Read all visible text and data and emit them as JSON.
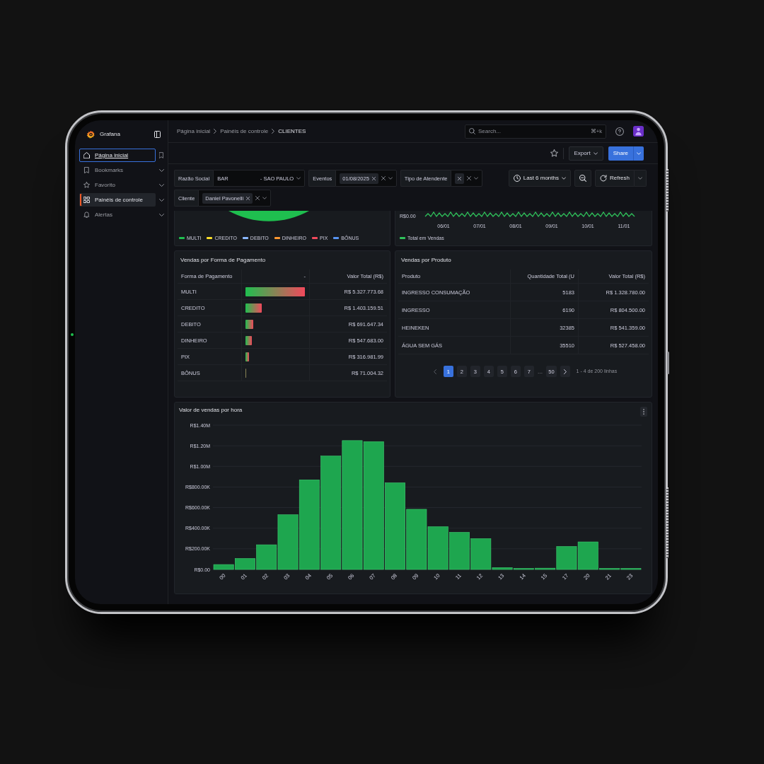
{
  "sidebar": {
    "brand": "Grafana",
    "items": [
      {
        "label": "Página inicial",
        "selected": false,
        "focused": true,
        "expandable": false
      },
      {
        "label": "Bookmarks",
        "selected": false,
        "focused": false,
        "expandable": true
      },
      {
        "label": "Favorito",
        "selected": false,
        "focused": false,
        "expandable": true
      },
      {
        "label": "Painéis de controle",
        "selected": true,
        "focused": false,
        "expandable": true
      },
      {
        "label": "Alertas",
        "selected": false,
        "focused": false,
        "expandable": true
      }
    ]
  },
  "header": {
    "breadcrumbs": [
      "Página inicial",
      "Painéis de controle",
      "CLIENTES"
    ],
    "search": {
      "placeholder": "Search...",
      "shortcut": "⌘+k"
    }
  },
  "toolbar": {
    "buttons": [
      {
        "label": "Export",
        "kind": "dropdown"
      },
      {
        "label": "Share",
        "kind": "split"
      }
    ]
  },
  "variable_rows": [
    [
      {
        "label": "Razão Social",
        "kind": "single",
        "value": "BAR",
        "value_suffix": "- SAO PAULO"
      },
      {
        "label": "Eventos",
        "kind": "multi",
        "chips": [
          {
            "kind": "text",
            "label": "01/08/2025"
          }
        ]
      },
      {
        "label": "Tipo de Atendente",
        "kind": "multi",
        "chips": [
          {
            "kind": "blank"
          }
        ]
      }
    ],
    [
      {
        "label": "Cliente",
        "kind": "multi",
        "chips": [
          {
            "kind": "text",
            "label": "Daniel Pavonelli"
          }
        ]
      }
    ]
  ],
  "time_range": {
    "label": "Last 6 months"
  },
  "refresh": {
    "label": "Refresh"
  },
  "pie_panel": {
    "legend": [
      {
        "label": "MULTI",
        "color": "#1fbf4f"
      },
      {
        "label": "CREDITO",
        "color": "#fade2a"
      },
      {
        "label": "DEBITO",
        "color": "#8ab8ff"
      },
      {
        "label": "DINHEIRO",
        "color": "#ff9830"
      },
      {
        "label": "PIX",
        "color": "#f2495c"
      },
      {
        "label": "BÔNUS",
        "color": "#5794f2"
      }
    ]
  },
  "line_panel": {
    "y_tick": "R$0.00",
    "x_ticks": [
      "06/01",
      "07/01",
      "08/01",
      "09/01",
      "10/01",
      "11/01"
    ],
    "legend": [
      {
        "label": "Total em Vendas",
        "color": "#2fc25b"
      }
    ]
  },
  "payment_panel": {
    "title": "Vendas por Forma de Pagamento",
    "columns": [
      "Forma de Pagamento",
      "-",
      "Valor Total (R$)"
    ],
    "rows": [
      {
        "method": "MULTI",
        "level": 0.97,
        "total": "R$ 5.327.773.68"
      },
      {
        "method": "CREDITO",
        "level": 0.26,
        "total": "R$ 1.403.159.51"
      },
      {
        "method": "DEBITO",
        "level": 0.13,
        "total": "R$ 691.647.34"
      },
      {
        "method": "DINHEIRO",
        "level": 0.1,
        "total": "R$ 547.683.00"
      },
      {
        "method": "PIX",
        "level": 0.06,
        "total": "R$ 316.981.99"
      },
      {
        "method": "BÔNUS",
        "level": 0.015,
        "total": "R$ 71.004.32"
      }
    ]
  },
  "product_panel": {
    "title": "Vendas por Produto",
    "columns": [
      "Produto",
      "Quantidade Total (U",
      "Valor Total (R$)"
    ],
    "rows": [
      {
        "product": "INGRESSO CONSUMAÇÃO",
        "quantity": "5183",
        "total": "R$ 1.328.780.00"
      },
      {
        "product": "INGRESSO",
        "quantity": "6190",
        "total": "R$ 804.500.00"
      },
      {
        "product": "HEINEKEN",
        "quantity": "32385",
        "total": "R$ 541.359.00"
      },
      {
        "product": "ÁGUA SEM GÁS",
        "quantity": "35510",
        "total": "R$ 527.458.00"
      }
    ],
    "pagination": {
      "prev": {
        "disabled": true
      },
      "next": {
        "disabled": false
      },
      "pages": [
        {
          "label": "1",
          "kind": "page",
          "selected": true
        },
        {
          "label": "2",
          "kind": "page",
          "selected": false
        },
        {
          "label": "3",
          "kind": "page",
          "selected": false
        },
        {
          "label": "4",
          "kind": "page",
          "selected": false
        },
        {
          "label": "5",
          "kind": "page",
          "selected": false
        },
        {
          "label": "6",
          "kind": "page",
          "selected": false
        },
        {
          "label": "7",
          "kind": "page",
          "selected": false
        },
        {
          "label": "…",
          "kind": "ellipsis"
        },
        {
          "label": "50",
          "kind": "page",
          "selected": false
        }
      ],
      "summary": "1 - 4 de 200 linhas"
    }
  },
  "hourly_panel": {
    "title": "Valor de vendas por hora",
    "y_axis_labels": [
      "R$1.40M",
      "R$1.20M",
      "R$1.00M",
      "R$800.00K",
      "R$600.00K",
      "R$400.00K",
      "R$200.00K",
      "R$0.00"
    ],
    "x_axis_labels": [
      "00",
      "01",
      "02",
      "03",
      "04",
      "05",
      "06",
      "07",
      "08",
      "09",
      "10",
      "11",
      "12",
      "13",
      "14",
      "15",
      "17",
      "20",
      "21",
      "23"
    ]
  }
}
